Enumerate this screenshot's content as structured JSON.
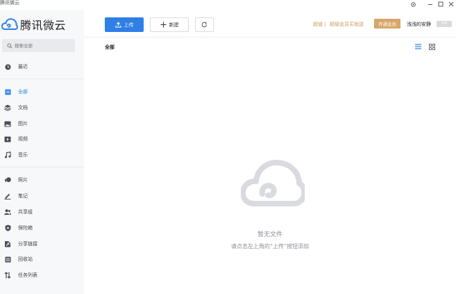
{
  "window": {
    "title": "腾讯微云"
  },
  "logo": {
    "text": "腾讯微云"
  },
  "search": {
    "placeholder": "搜索全部"
  },
  "sidebar": {
    "items": [
      {
        "label": "最近",
        "icon": "clock-icon"
      },
      {
        "label": "全部",
        "icon": "all-files-icon",
        "active": true
      },
      {
        "label": "文档",
        "icon": "layers-icon"
      },
      {
        "label": "图片",
        "icon": "image-icon"
      },
      {
        "label": "视频",
        "icon": "video-icon"
      },
      {
        "label": "音乐",
        "icon": "music-icon"
      },
      {
        "label": "照片",
        "icon": "photo-icon"
      },
      {
        "label": "笔记",
        "icon": "pen-icon"
      },
      {
        "label": "共享组",
        "icon": "group-icon"
      },
      {
        "label": "保险箱",
        "icon": "shield-icon"
      },
      {
        "label": "分享链接",
        "icon": "share-link-icon"
      },
      {
        "label": "回收站",
        "icon": "trash-icon"
      },
      {
        "label": "任务列表",
        "icon": "transfer-icon"
      }
    ]
  },
  "toolbar": {
    "upload_label": "上传",
    "new_label": "新建"
  },
  "header": {
    "promo_prefix": "超值",
    "promo_separator": "|",
    "promo_text": "超级会员买就送",
    "vip_button": "开通会员",
    "username": "浅浅的安静",
    "vip_badge": "VIP"
  },
  "breadcrumb": {
    "current": "全部"
  },
  "empty_state": {
    "title": "暂无文件",
    "hint": "请点击左上角的“上传”按钮添加"
  },
  "colors": {
    "accent": "#2f7fe6",
    "vip": "#d7a66a",
    "sidebar_bg": "#f7f8fa"
  }
}
